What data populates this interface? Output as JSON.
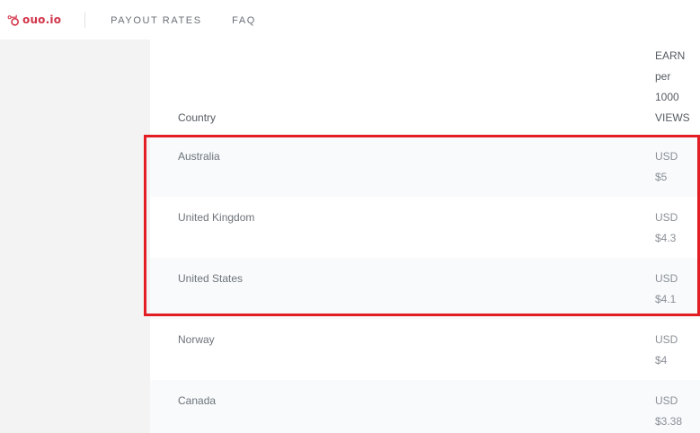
{
  "brand": {
    "name": "ouo.io",
    "accent": "#d2354a"
  },
  "nav": {
    "payout_rates": "PAYOUT RATES",
    "faq": "FAQ"
  },
  "table": {
    "header": {
      "country": "Country",
      "earn_lines": [
        "EARN",
        "per",
        "1000",
        "VIEWS"
      ]
    },
    "rows": [
      {
        "country": "Australia",
        "currency": "USD",
        "amount": "$5"
      },
      {
        "country": "United Kingdom",
        "currency": "USD",
        "amount": "$4.3"
      },
      {
        "country": "United States",
        "currency": "USD",
        "amount": "$4.1"
      },
      {
        "country": "Norway",
        "currency": "USD",
        "amount": "$4"
      },
      {
        "country": "Canada",
        "currency": "USD",
        "amount": "$3.38"
      }
    ]
  },
  "highlight_color": "#e21d24"
}
